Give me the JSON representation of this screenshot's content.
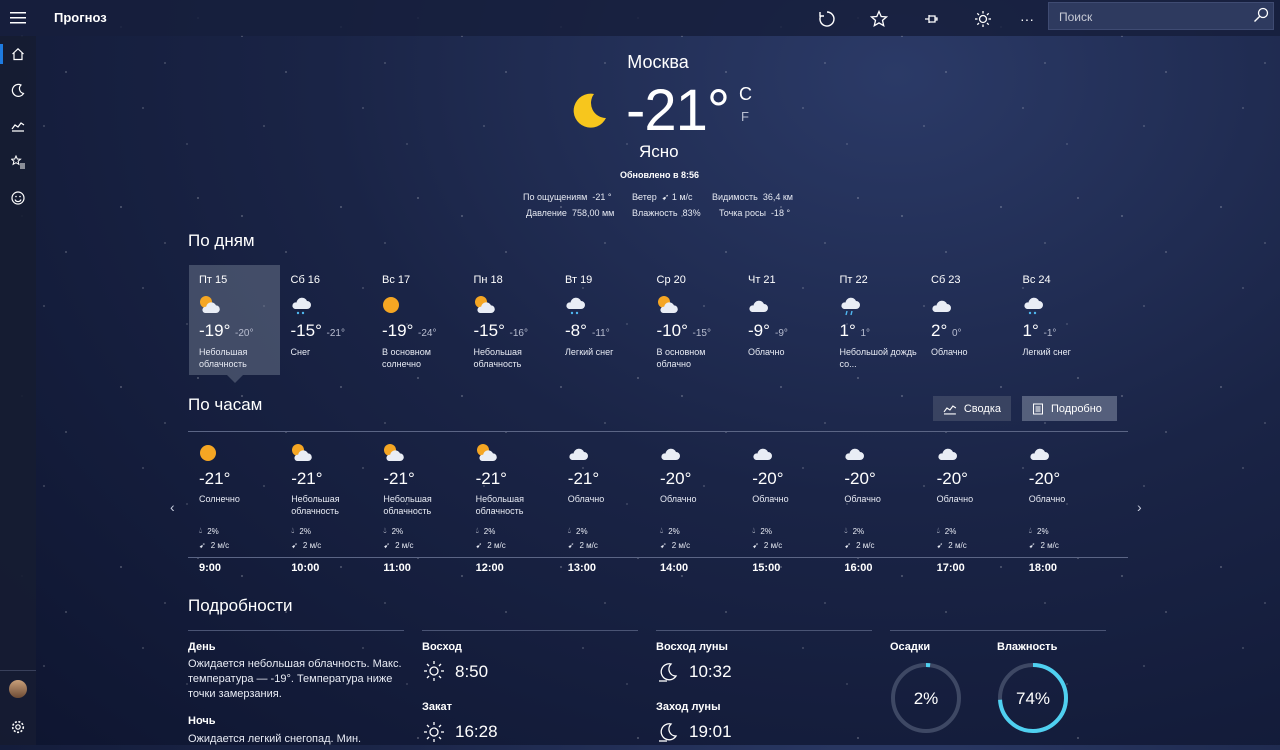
{
  "app": {
    "title": "Прогноз"
  },
  "search": {
    "placeholder": "Поиск"
  },
  "current": {
    "city": "Москва",
    "temp": "-21°",
    "unit_c": "C",
    "unit_f": "F",
    "condition": "Ясно",
    "updated": "Обновлено в 8:56",
    "feels_label": "По ощущениям",
    "feels": "-21 °",
    "wind_label": "Ветер",
    "wind": "1 м/с",
    "visibility_label": "Видимость",
    "visibility": "36,4 км",
    "pressure_label": "Давление",
    "pressure": "758,00 мм",
    "humidity_label": "Влажность",
    "humidity": "83%",
    "dew_label": "Точка росы",
    "dew": "-18 °"
  },
  "daily": {
    "title": "По дням",
    "days": [
      {
        "name": "Пт 15",
        "hi": "-19°",
        "lo": "-20°",
        "desc": "Небольшая облачность",
        "icon": "partly-cloudy-icon"
      },
      {
        "name": "Сб 16",
        "hi": "-15°",
        "lo": "-21°",
        "desc": "Снег",
        "icon": "snow-icon"
      },
      {
        "name": "Вс 17",
        "hi": "-19°",
        "lo": "-24°",
        "desc": "В основном солнечно",
        "icon": "sun-icon"
      },
      {
        "name": "Пн 18",
        "hi": "-15°",
        "lo": "-16°",
        "desc": "Небольшая облачность",
        "icon": "partly-cloudy-icon"
      },
      {
        "name": "Вт 19",
        "hi": "-8°",
        "lo": "-11°",
        "desc": "Легкий снег",
        "icon": "snow-icon"
      },
      {
        "name": "Ср 20",
        "hi": "-10°",
        "lo": "-15°",
        "desc": "В основном облачно",
        "icon": "partly-cloudy-icon"
      },
      {
        "name": "Чт 21",
        "hi": "-9°",
        "lo": "-9°",
        "desc": "Облачно",
        "icon": "cloud-icon"
      },
      {
        "name": "Пт 22",
        "hi": "1°",
        "lo": "1°",
        "desc": "Небольшой дождь со...",
        "icon": "rain-icon"
      },
      {
        "name": "Сб 23",
        "hi": "2°",
        "lo": "0°",
        "desc": "Облачно",
        "icon": "cloud-icon"
      },
      {
        "name": "Вс 24",
        "hi": "1°",
        "lo": "-1°",
        "desc": "Легкий снег",
        "icon": "snow-icon"
      }
    ]
  },
  "hourly": {
    "title": "По часам",
    "summary_btn": "Сводка",
    "details_btn": "Подробно",
    "hours": [
      {
        "temp": "-21°",
        "desc": "Солнечно",
        "prec": "2%",
        "wind": "2 м/с",
        "time": "9:00",
        "icon": "sun-icon"
      },
      {
        "temp": "-21°",
        "desc": "Небольшая облачность",
        "prec": "2%",
        "wind": "2 м/с",
        "time": "10:00",
        "icon": "partly-cloudy-icon"
      },
      {
        "temp": "-21°",
        "desc": "Небольшая облачность",
        "prec": "2%",
        "wind": "2 м/с",
        "time": "11:00",
        "icon": "partly-cloudy-icon"
      },
      {
        "temp": "-21°",
        "desc": "Небольшая облачность",
        "prec": "2%",
        "wind": "2 м/с",
        "time": "12:00",
        "icon": "partly-cloudy-icon"
      },
      {
        "temp": "-21°",
        "desc": "Облачно",
        "prec": "2%",
        "wind": "2 м/с",
        "time": "13:00",
        "icon": "cloud-icon"
      },
      {
        "temp": "-20°",
        "desc": "Облачно",
        "prec": "2%",
        "wind": "2 м/с",
        "time": "14:00",
        "icon": "cloud-icon"
      },
      {
        "temp": "-20°",
        "desc": "Облачно",
        "prec": "2%",
        "wind": "2 м/с",
        "time": "15:00",
        "icon": "cloud-icon"
      },
      {
        "temp": "-20°",
        "desc": "Облачно",
        "prec": "2%",
        "wind": "2 м/с",
        "time": "16:00",
        "icon": "cloud-icon"
      },
      {
        "temp": "-20°",
        "desc": "Облачно",
        "prec": "2%",
        "wind": "2 м/с",
        "time": "17:00",
        "icon": "cloud-icon"
      },
      {
        "temp": "-20°",
        "desc": "Облачно",
        "prec": "2%",
        "wind": "2 м/с",
        "time": "18:00",
        "icon": "cloud-icon"
      }
    ]
  },
  "details": {
    "title": "Подробности",
    "day_label": "День",
    "day_text": "Ожидается небольшая облачность. Макс. температура — -19°. Температура ниже точки замерзания.",
    "night_label": "Ночь",
    "night_text": "Ожидается легкий снегопад. Мин.",
    "sunrise_label": "Восход",
    "sunrise": "8:50",
    "sunset_label": "Закат",
    "sunset": "16:28",
    "moonrise_label": "Восход луны",
    "moonrise": "10:32",
    "moonset_label": "Заход луны",
    "moonset": "19:01",
    "precip_label": "Осадки",
    "precip_value": "2%",
    "precip_fraction": 0.02,
    "humidity_label": "Влажность",
    "humidity_value": "74%",
    "humidity_fraction": 0.74
  },
  "colors": {
    "accent": "#1e7be0",
    "ring": "#4fd0f0",
    "ring_track": "#3e4864"
  }
}
